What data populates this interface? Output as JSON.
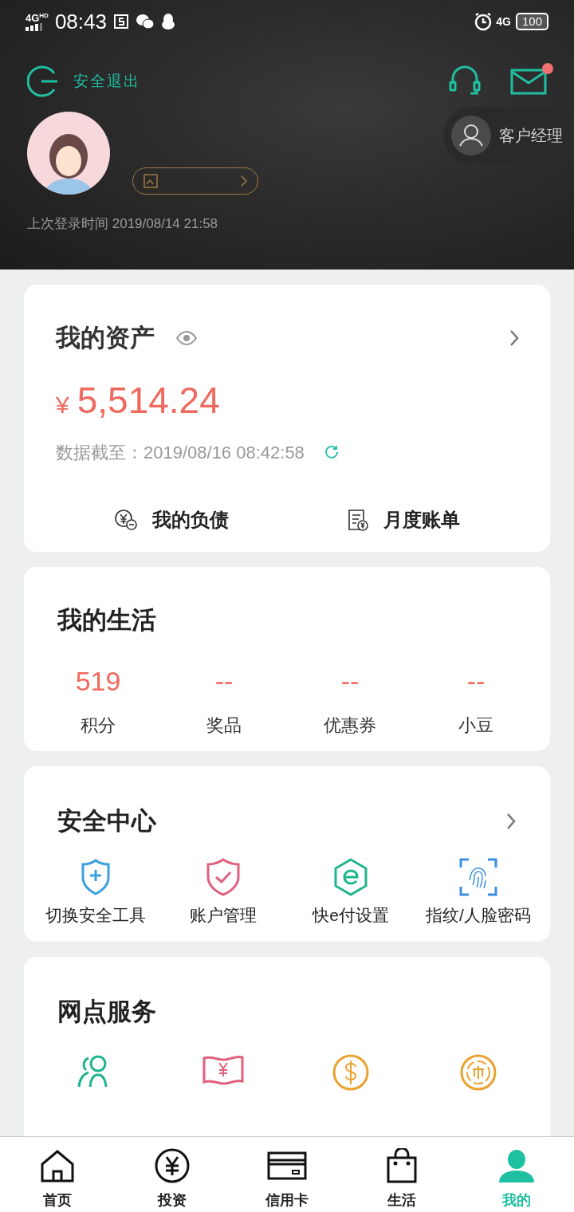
{
  "status_bar": {
    "carrier": "4G",
    "carrier_hd": "HD",
    "time": "08:43",
    "network": "4G",
    "battery": "100"
  },
  "header": {
    "logout": "安全退出",
    "mail_unread": true,
    "manager": "客户经理",
    "last_login": "上次登录时间 2019/08/14 21:58"
  },
  "assets": {
    "title": "我的资产",
    "currency": "¥",
    "amount": "5,514.24",
    "as_of": "数据截至：2019/08/16 08:42:58",
    "links": [
      {
        "label": "我的负债",
        "kind": "debt"
      },
      {
        "label": "月度账单",
        "kind": "bill"
      }
    ]
  },
  "life": {
    "title": "我的生活",
    "stats": [
      {
        "value": "519",
        "label": "积分"
      },
      {
        "value": "--",
        "label": "奖品"
      },
      {
        "value": "--",
        "label": "优惠券"
      },
      {
        "value": "--",
        "label": "小豆"
      }
    ]
  },
  "security": {
    "title": "安全中心",
    "items": [
      {
        "label": "切换安全工具",
        "kind": "shield-plus"
      },
      {
        "label": "账户管理",
        "kind": "shield-check"
      },
      {
        "label": "快e付设置",
        "kind": "hex-e"
      },
      {
        "label": "指纹/人脸密码",
        "kind": "fingerprint"
      }
    ]
  },
  "branch": {
    "title": "网点服务",
    "items": [
      {
        "kind": "people"
      },
      {
        "kind": "banknote"
      },
      {
        "kind": "dollar"
      },
      {
        "kind": "coin"
      }
    ]
  },
  "tabs": [
    {
      "label": "首页",
      "kind": "home",
      "selected": false
    },
    {
      "label": "投资",
      "kind": "yen",
      "selected": false
    },
    {
      "label": "信用卡",
      "kind": "card",
      "selected": false
    },
    {
      "label": "生活",
      "kind": "bag",
      "selected": false
    },
    {
      "label": "我的",
      "kind": "person",
      "selected": true
    }
  ]
}
